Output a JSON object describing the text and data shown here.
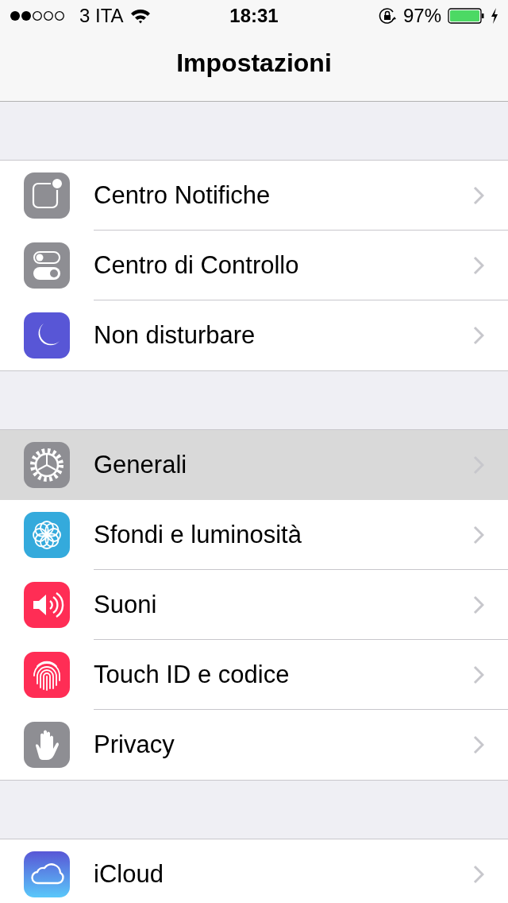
{
  "status_bar": {
    "carrier": "3 ITA",
    "time": "18:31",
    "battery": "97%"
  },
  "nav": {
    "title": "Impostazioni"
  },
  "groups": [
    {
      "items": [
        {
          "label": "Centro Notifiche",
          "kind": "notifications",
          "selected": false
        },
        {
          "label": "Centro di Controllo",
          "kind": "control",
          "selected": false
        },
        {
          "label": "Non disturbare",
          "kind": "moon",
          "selected": false
        }
      ]
    },
    {
      "items": [
        {
          "label": "Generali",
          "kind": "gear",
          "selected": true
        },
        {
          "label": "Sfondi e luminosità",
          "kind": "flower",
          "selected": false
        },
        {
          "label": "Suoni",
          "kind": "sound",
          "selected": false
        },
        {
          "label": "Touch ID e codice",
          "kind": "fingerprint",
          "selected": false
        },
        {
          "label": "Privacy",
          "kind": "hand",
          "selected": false
        }
      ]
    },
    {
      "items": [
        {
          "label": "iCloud",
          "kind": "cloud",
          "selected": false
        }
      ]
    }
  ]
}
